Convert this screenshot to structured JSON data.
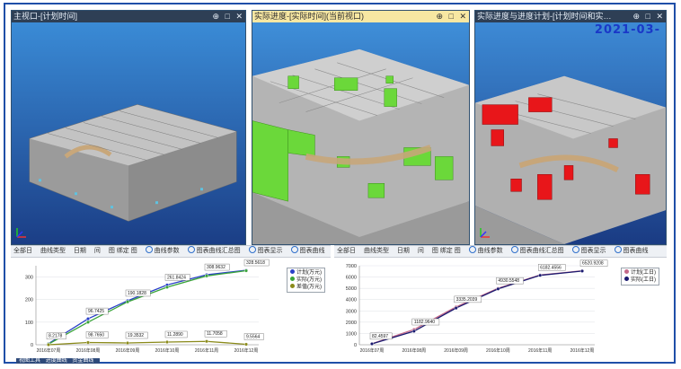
{
  "viewports": [
    {
      "title": "主视口-[计划时间]",
      "controls": [
        "⊕",
        "□",
        "✕"
      ],
      "active": false
    },
    {
      "title": "实际进度-[实际时间](当前视口)",
      "controls": [
        "⊕",
        "□",
        "✕"
      ],
      "active": true
    },
    {
      "title": "实际进度与进度计划-[计划时间和实…",
      "controls": [
        "⊕",
        "□",
        "✕"
      ],
      "active": false,
      "date_overlay": "2021-03-"
    }
  ],
  "toolbars": {
    "left": [
      "全部日",
      "曲线类型",
      "日期",
      "间",
      "图 绑定 图",
      "曲线参数",
      "图表曲线汇总图",
      "图表显示",
      "图表曲线"
    ],
    "right": [
      "全部日",
      "曲线类型",
      "日期",
      "间",
      "图 绑定 图",
      "曲线参数",
      "图表曲线汇总图",
      "图表显示",
      "图表曲线"
    ]
  },
  "bottom_tabs": [
    "视图工具",
    "进度曲线",
    "资金曲线"
  ],
  "colors": {
    "frame": "#1f4fa8",
    "series_plan": "#2a40c8",
    "series_actual": "#3aa43a",
    "series_diff": "#8a8a1a",
    "cum_plan": "#c46a8a",
    "cum_actual": "#1a1a70"
  },
  "chart_data": [
    {
      "type": "line",
      "categories": [
        "2016年07周",
        "2016年08周",
        "2016年09周",
        "2016年10周",
        "2016年11周",
        "2016年12周"
      ],
      "ylim": [
        0,
        350
      ],
      "yticks": [
        0,
        100,
        200,
        300
      ],
      "series": [
        {
          "name": "计划(万元)",
          "values": [
            5,
            115,
            195,
            265,
            310,
            330
          ]
        },
        {
          "name": "实际(万元)",
          "values": [
            3,
            100,
            190,
            255,
            305,
            328
          ]
        },
        {
          "name": "差值(万元)",
          "values": [
            0,
            10,
            8,
            12,
            15,
            2
          ]
        }
      ],
      "data_labels": [
        "8.2178",
        "96.7425",
        "190.1828",
        "261.8424",
        "308.9632",
        "328.5618",
        "98.7650",
        "19.3532",
        "11.2890",
        "11.7058",
        "9.5564"
      ],
      "legend": "top-right"
    },
    {
      "type": "line",
      "categories": [
        "2016年07周",
        "2016年08周",
        "2016年09周",
        "2016年10周",
        "2016年11周",
        "2016年12周"
      ],
      "ylim": [
        0,
        7000
      ],
      "yticks": [
        0,
        1000,
        2000,
        3000,
        4000,
        5000,
        6000,
        7000
      ],
      "series": [
        {
          "name": "计划(工日)",
          "values": [
            90,
            1350,
            3350,
            5000,
            6180,
            6550
          ]
        },
        {
          "name": "实际(工日)",
          "values": [
            80,
            1200,
            3250,
            4950,
            6150,
            6530
          ]
        }
      ],
      "data_labels": [
        "82.4597",
        "1182.9640",
        "3335.2039",
        "4930.5548",
        "6182.4556",
        "6520.9208"
      ],
      "legend": "top-right"
    }
  ]
}
